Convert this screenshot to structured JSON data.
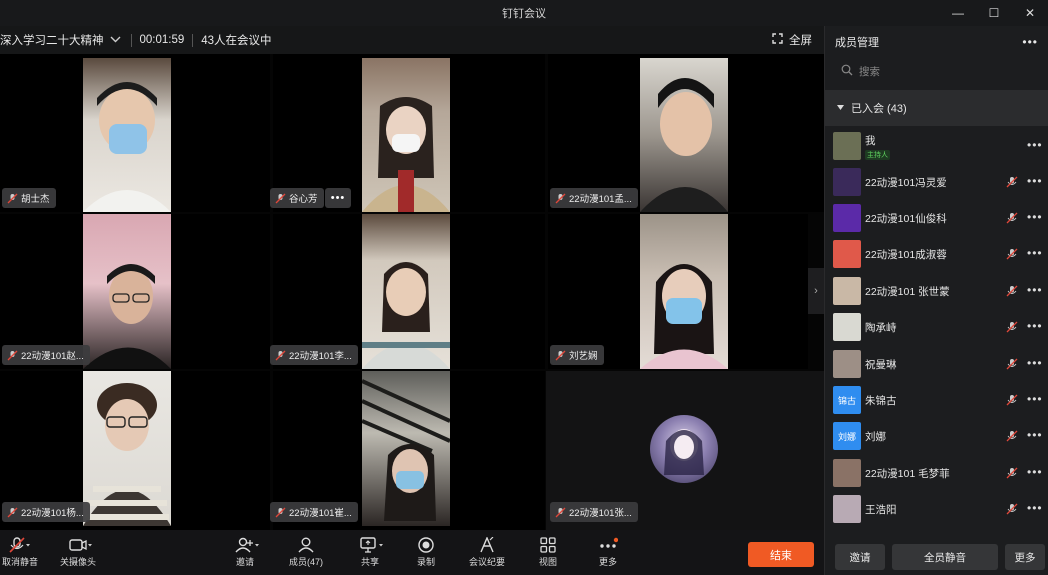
{
  "window": {
    "title": "钉钉会议",
    "min": "—",
    "max": "☐",
    "close": "✕"
  },
  "topbar": {
    "topic": "深入学习二十大精神",
    "timer": "00:01:59",
    "count": "43人在会议中",
    "fullscreen": "全屏"
  },
  "tiles": [
    {
      "name": "胡士杰"
    },
    {
      "name": "谷心芳"
    },
    {
      "name": "22动漫101孟..."
    },
    {
      "name": "22动漫101赵..."
    },
    {
      "name": "22动漫101李..."
    },
    {
      "name": "刘艺娴"
    },
    {
      "name": "22动漫101杨..."
    },
    {
      "name": "22动漫101崔..."
    },
    {
      "name": "22动漫101张..."
    }
  ],
  "toolbar": {
    "unmute": "取消静音",
    "camera_off": "关摄像头",
    "invite": "邀请",
    "members": "成员(47)",
    "share": "共享",
    "record": "录制",
    "minutes": "会议纪要",
    "view": "视图",
    "more": "更多",
    "end": "结束"
  },
  "panel": {
    "title": "成员管理",
    "search_placeholder": "搜索",
    "group": "已入会 (43)",
    "host_badge": "主持人",
    "members": [
      {
        "name": "我",
        "avatar_color": "#6b6f55"
      },
      {
        "name": "22动漫101冯灵爱",
        "avatar_color": "#3a2a5a"
      },
      {
        "name": "22动漫101仙俊科",
        "avatar_color": "#5b2aa8"
      },
      {
        "name": "22动漫101成淑蓉",
        "avatar_color": "#e0594a"
      },
      {
        "name": "22动漫101 张世蒙",
        "avatar_color": "#c9b8a6"
      },
      {
        "name": "陶承峙",
        "avatar_color": "#d9d9d2"
      },
      {
        "name": "祝曼琳",
        "avatar_color": "#9d8f86"
      },
      {
        "name": "朱锦古",
        "avatar_text": "锦古",
        "avatar_color": "#2f8df0"
      },
      {
        "name": "刘娜",
        "avatar_text": "刘娜",
        "avatar_color": "#2f8df0"
      },
      {
        "name": "22动漫101  毛梦菲",
        "avatar_color": "#8a7266"
      },
      {
        "name": "王浩阳",
        "avatar_color": "#b8aab4"
      }
    ],
    "invite": "邀请",
    "mute_all": "全员静音",
    "more": "更多"
  },
  "colors": {
    "accent_end": "#f05a24",
    "host_green": "#5fd35f",
    "mic_muted": "#e0473a"
  }
}
